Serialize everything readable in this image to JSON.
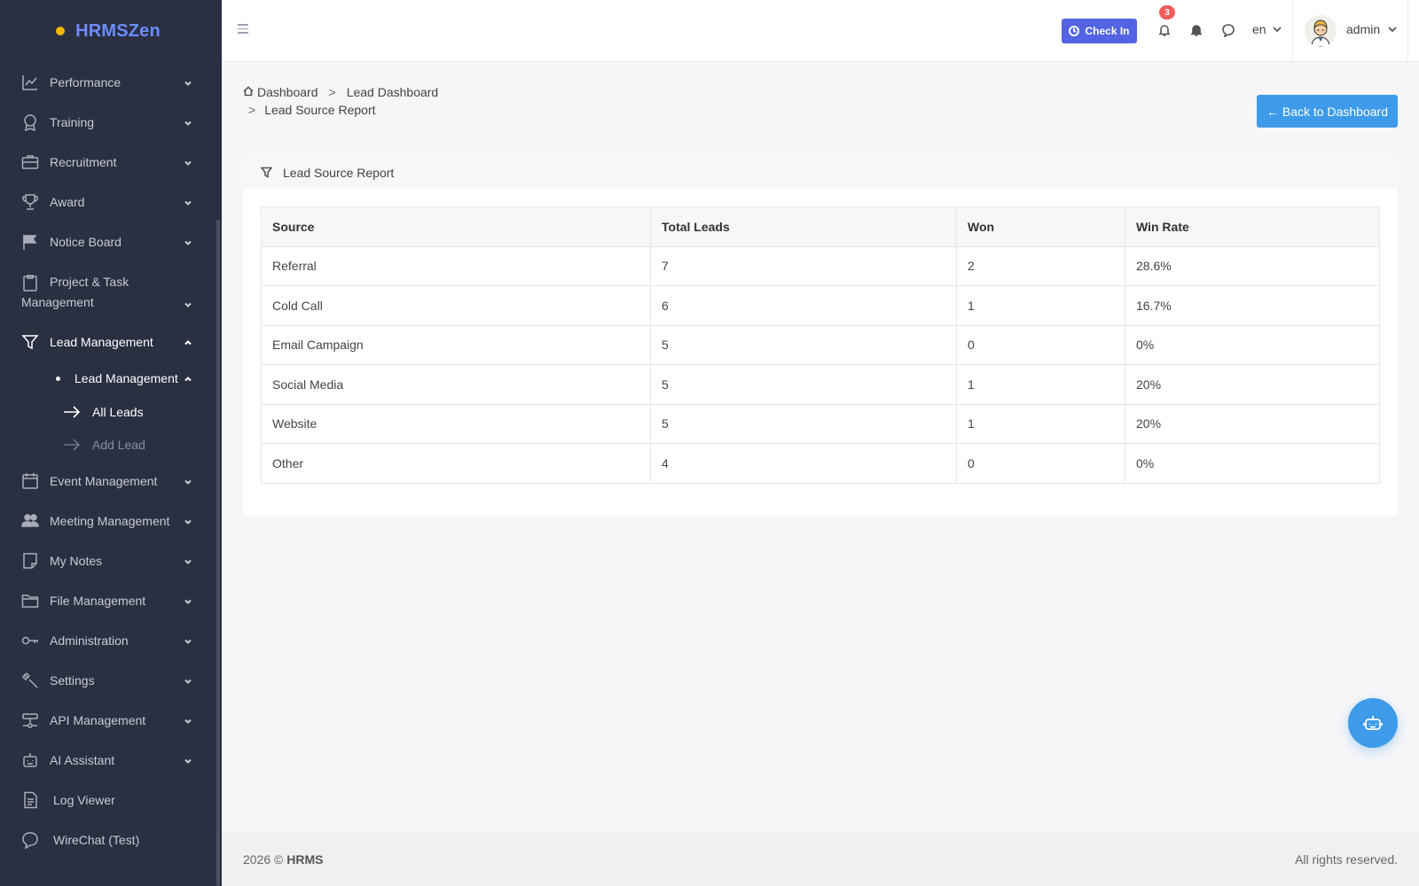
{
  "brand": {
    "name": "HRMSZen"
  },
  "sidebar": {
    "items": [
      {
        "label": "Performance",
        "icon": "chart-line-icon"
      },
      {
        "label": "Training",
        "icon": "award-ribbon-icon"
      },
      {
        "label": "Recruitment",
        "icon": "briefcase-icon"
      },
      {
        "label": "Award",
        "icon": "trophy-icon"
      },
      {
        "label": "Notice Board",
        "icon": "flag-icon"
      },
      {
        "label": "Project & Task Management",
        "icon": "clipboard-icon"
      },
      {
        "label": "Lead Management",
        "icon": "funnel-icon"
      },
      {
        "label": "Event Management",
        "icon": "calendar-icon"
      },
      {
        "label": "Meeting Management",
        "icon": "users-icon"
      },
      {
        "label": "My Notes",
        "icon": "note-icon"
      },
      {
        "label": "File Management",
        "icon": "folder-icon"
      },
      {
        "label": "Administration",
        "icon": "key-icon"
      },
      {
        "label": "Settings",
        "icon": "wrench-icon"
      },
      {
        "label": "API Management",
        "icon": "server-icon"
      },
      {
        "label": "AI Assistant",
        "icon": "robot-icon"
      },
      {
        "label": "Log Viewer",
        "icon": "document-icon"
      },
      {
        "label": "WireChat (Test)",
        "icon": "chat-icon"
      }
    ],
    "lead_sub": {
      "label": "Lead Management",
      "children": [
        {
          "label": "All Leads",
          "active": true
        },
        {
          "label": "Add Lead",
          "active": false
        }
      ]
    }
  },
  "header": {
    "checkin_label": "Check In",
    "notification_count": "3",
    "language": "en",
    "user": "admin"
  },
  "breadcrumb": {
    "home": "Dashboard",
    "parent": "Lead Dashboard",
    "current": "Lead Source Report",
    "separator": ">"
  },
  "back_button": "← Back to Dashboard",
  "report": {
    "title": "Lead Source Report",
    "columns": [
      "Source",
      "Total Leads",
      "Won",
      "Win Rate"
    ],
    "rows": [
      [
        "Referral",
        "7",
        "2",
        "28.6%"
      ],
      [
        "Cold Call",
        "6",
        "1",
        "16.7%"
      ],
      [
        "Email Campaign",
        "5",
        "0",
        "0%"
      ],
      [
        "Social Media",
        "5",
        "1",
        "20%"
      ],
      [
        "Website",
        "5",
        "1",
        "20%"
      ],
      [
        "Other",
        "4",
        "0",
        "0%"
      ]
    ]
  },
  "footer": {
    "year": "2026 © ",
    "brand": "HRMS",
    "rights": "All rights reserved."
  },
  "colors": {
    "sidebar_bg": "#2a2f42",
    "brand_accent": "#6c8cff",
    "primary": "#3d9bea",
    "checkin": "#5264e3",
    "badge": "#f25c5c"
  }
}
